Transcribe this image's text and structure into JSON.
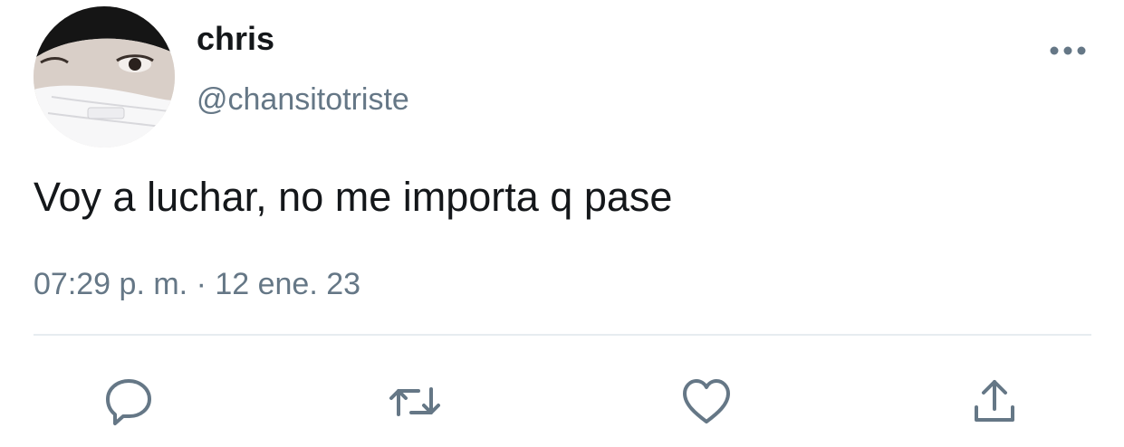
{
  "user": {
    "display_name": "chris",
    "handle": "@chansitotriste"
  },
  "tweet": {
    "text": "Voy a luchar, no me importa q pase",
    "time": "07:29 p. m.",
    "separator": "·",
    "date": "12 ene. 23"
  },
  "icons": {
    "more": "more-horizontal-icon",
    "reply": "reply-icon",
    "retweet": "retweet-icon",
    "like": "heart-icon",
    "share": "share-icon"
  },
  "colors": {
    "text_primary": "#14171a",
    "text_secondary": "#657786",
    "divider": "#e6ecf0",
    "icon": "#657786"
  }
}
